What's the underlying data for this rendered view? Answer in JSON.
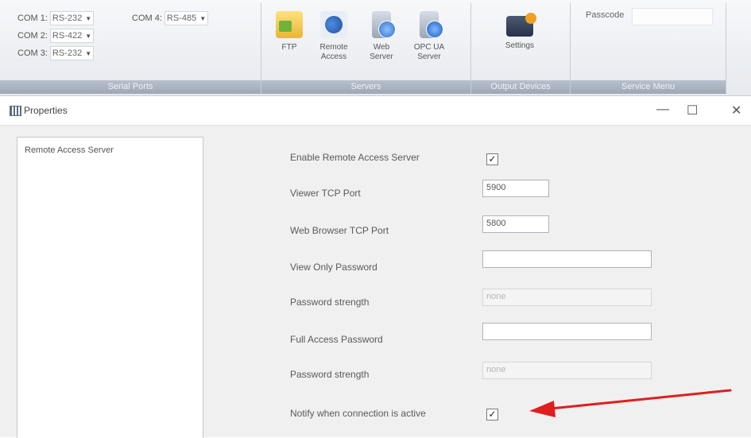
{
  "ribbon": {
    "serial_ports": {
      "title": "Serial Ports",
      "rows": [
        {
          "label": "COM 1:",
          "value": "RS-232"
        },
        {
          "label": "COM 2:",
          "value": "RS-422"
        },
        {
          "label": "COM 3:",
          "value": "RS-232"
        },
        {
          "label": "COM 4:",
          "value": "RS-485"
        }
      ]
    },
    "servers": {
      "title": "Servers",
      "buttons": [
        {
          "label": "FTP",
          "icon": "ftp-folder-icon"
        },
        {
          "label": "Remote Access",
          "icon": "remote-access-icon"
        },
        {
          "label": "Web Server",
          "icon": "web-server-icon"
        },
        {
          "label": "OPC UA Server",
          "icon": "opc-ua-server-icon"
        }
      ]
    },
    "output_devices": {
      "title": "Output Devices",
      "settings_label": "Settings"
    },
    "service_menu": {
      "title": "Service Menu",
      "passcode_label": "Passcode",
      "passcode_value": ""
    }
  },
  "window": {
    "title": "Properties",
    "controls": {
      "minimize": "—",
      "maximize": "☐",
      "close": "✕"
    }
  },
  "tree": {
    "items": [
      "Remote Access Server"
    ]
  },
  "form": {
    "enable_label": "Enable Remote Access Server",
    "enable_checked": true,
    "viewer_port_label": "Viewer TCP Port",
    "viewer_port_value": "5900",
    "web_port_label": "Web Browser TCP Port",
    "web_port_value": "5800",
    "view_only_pw_label": "View Only Password",
    "view_only_pw_value": "",
    "pw_strength_label_1": "Password strength",
    "pw_strength_value_1": "none",
    "full_access_pw_label": "Full Access Password",
    "full_access_pw_value": "",
    "pw_strength_label_2": "Password strength",
    "pw_strength_value_2": "none",
    "notify_label": "Notify when connection is active",
    "notify_checked": true
  },
  "colors": {
    "arrow": "#e01e1e",
    "group_title_bg": "#a4aebc"
  }
}
